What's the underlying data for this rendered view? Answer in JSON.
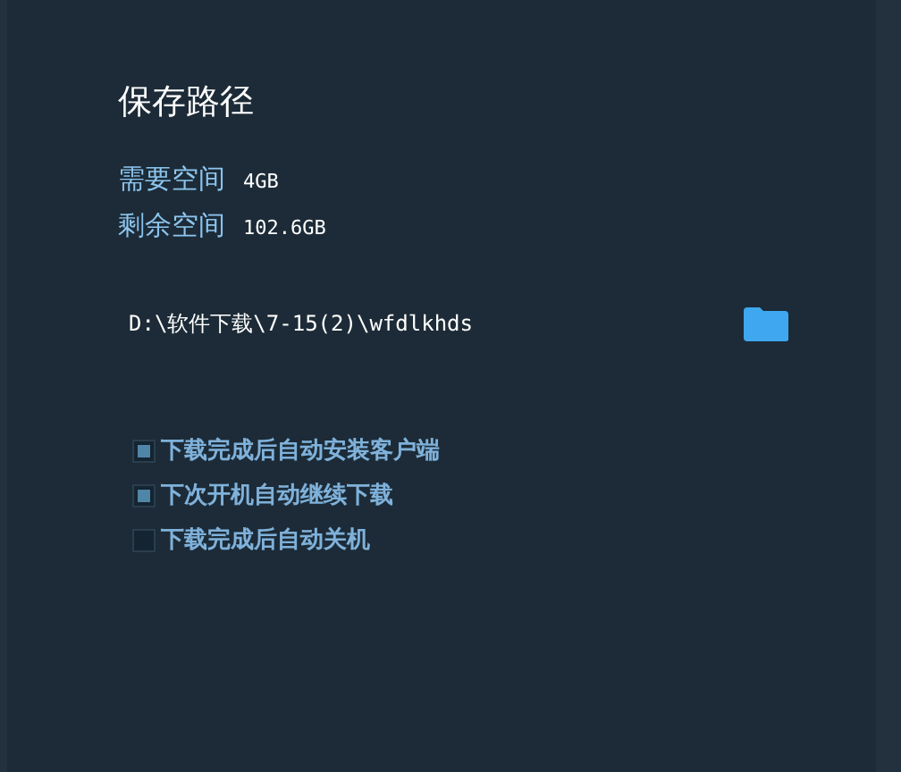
{
  "title": "保存路径",
  "space": [
    {
      "label": "需要空间",
      "value": "4GB"
    },
    {
      "label": "剩余空间",
      "value": "102.6GB"
    }
  ],
  "path": {
    "value": "D:\\软件下载\\7-15(2)\\wfdlkhds"
  },
  "options": [
    {
      "label": "下载完成后自动安装客户端",
      "checked": true
    },
    {
      "label": "下次开机自动继续下载",
      "checked": true
    },
    {
      "label": "下载完成后自动关机",
      "checked": false
    }
  ]
}
